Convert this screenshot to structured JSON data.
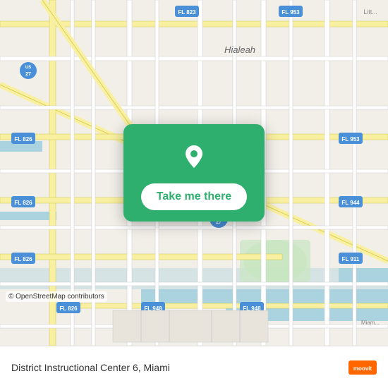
{
  "map": {
    "osm_credit": "© OpenStreetMap contributors"
  },
  "overlay": {
    "button_label": "Take me there",
    "pin_color": "#ffffff"
  },
  "bottom_bar": {
    "location_text": "District Instructional Center 6, Miami",
    "logo_text": "moovit"
  }
}
